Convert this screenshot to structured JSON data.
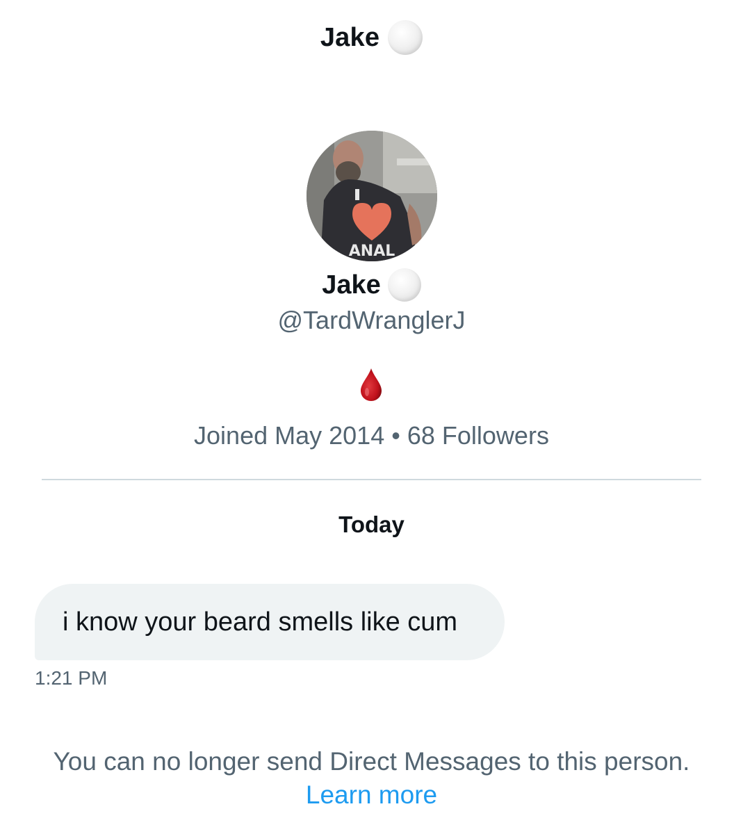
{
  "header": {
    "title": "Jake",
    "verified_icon": "white-circle-emoji"
  },
  "profile": {
    "name": "Jake",
    "name_icon": "white-circle-emoji",
    "handle": "@TardWranglerJ",
    "bio_icon": "drop-of-blood-emoji",
    "joined": "Joined May 2014",
    "separator": "•",
    "followers": "68 Followers",
    "avatar_shirt_text": "ANAL",
    "avatar_shirt_top": "I"
  },
  "conversation": {
    "date_label": "Today",
    "messages": [
      {
        "text": "i know your beard smells like cum",
        "time": "1:21 PM"
      }
    ]
  },
  "footer": {
    "notice": "You can no longer send Direct Messages to this person.",
    "link_label": "Learn more"
  },
  "colors": {
    "text_primary": "#0f1419",
    "text_secondary": "#536471",
    "link": "#1d9bf0",
    "bubble_bg": "#eff3f4",
    "divider": "#cfd9de"
  }
}
